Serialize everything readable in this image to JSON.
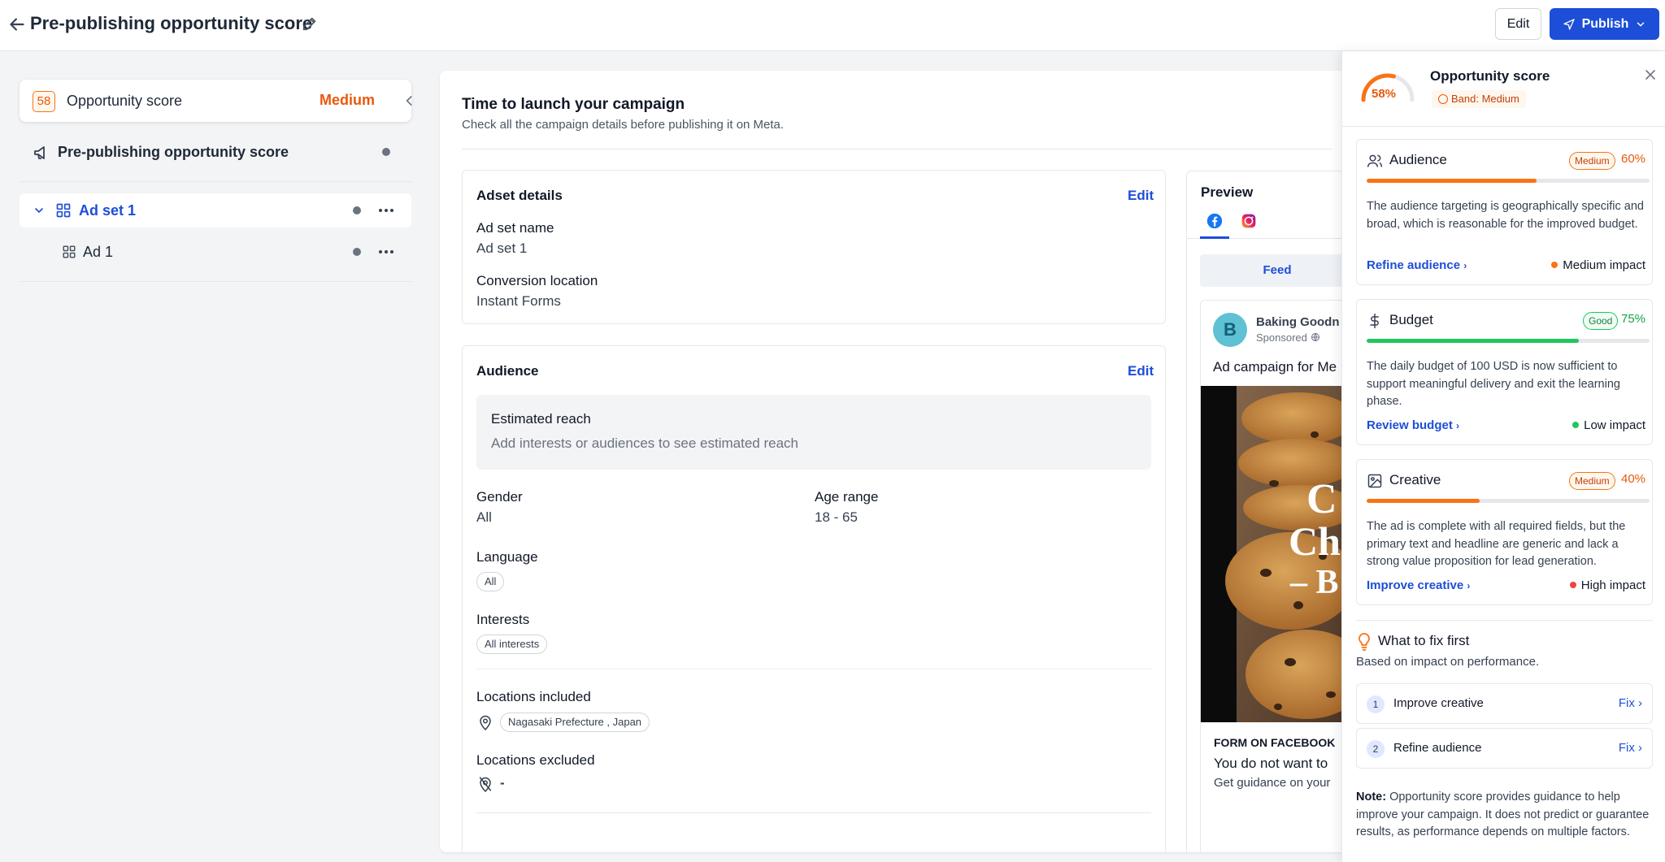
{
  "header": {
    "title": "Pre-publishing opportunity score",
    "edit_label": "Edit",
    "publish_label": "Publish"
  },
  "sidebar": {
    "score_value": "58",
    "score_label": "Opportunity score",
    "score_band": "Medium",
    "prepub_label": "Pre-publishing opportunity score",
    "adset_label": "Ad set 1",
    "ad_label": "Ad 1"
  },
  "main": {
    "title": "Time to launch your campaign",
    "subtitle": "Check all the campaign details before publishing it on Meta.",
    "adset_details": {
      "title": "Adset details",
      "edit": "Edit",
      "name_label": "Ad set name",
      "name_value": "Ad set 1",
      "conv_label": "Conversion location",
      "conv_value": "Instant Forms"
    },
    "audience": {
      "title": "Audience",
      "edit": "Edit",
      "reach_label": "Estimated reach",
      "reach_hint": "Add interests or audiences to see estimated reach",
      "gender_label": "Gender",
      "gender_value": "All",
      "age_label": "Age range",
      "age_value": "18 - 65",
      "language_label": "Language",
      "language_chip": "All",
      "interests_label": "Interests",
      "interests_chip": "All interests",
      "loc_in_label": "Locations included",
      "loc_in_chip": "Nagasaki Prefecture , Japan",
      "loc_ex_label": "Locations excluded",
      "loc_ex_value": "-"
    },
    "preview": {
      "title": "Preview",
      "feed_tab": "Feed",
      "avatar_letter": "B",
      "brand": "Baking Goodn",
      "sponsored": "Sponsored",
      "caption": "Ad campaign for Me",
      "img_text1": "C",
      "img_text2": "Ch",
      "img_text3": "– B",
      "foot1": "FORM ON FACEBOOK",
      "foot2": "You do not want to",
      "foot3": "Get guidance on your"
    }
  },
  "panel": {
    "score_pct": "58%",
    "score_fraction": 0.58,
    "title": "Opportunity score",
    "band": "Band: Medium",
    "criteria": [
      {
        "name": "Audience",
        "badge": "Medium",
        "pct": "60%",
        "level": 0.6,
        "color": "#f97316",
        "desc": "The audience targeting is geographically specific and broad, which is reasonable for the improved budget.",
        "action": "Refine audience",
        "impact": "Medium impact",
        "impact_color": "#f97316"
      },
      {
        "name": "Budget",
        "badge": "Good",
        "pct": "75%",
        "level": 0.75,
        "color": "#22c55e",
        "desc": "The daily budget of 100 USD is now sufficient to support meaningful delivery and exit the learning phase.",
        "action": "Review budget",
        "impact": "Low impact",
        "impact_color": "#22c55e"
      },
      {
        "name": "Creative",
        "badge": "Medium",
        "pct": "40%",
        "level": 0.4,
        "color": "#f97316",
        "desc": "The ad is complete with all required fields, but the primary text and headline are generic and lack a strong value proposition for lead generation.",
        "action": "Improve creative",
        "impact": "High impact",
        "impact_color": "#ef4444"
      }
    ],
    "fix_title": "What to fix first",
    "fix_subtitle": "Based on impact on performance.",
    "fixes": [
      {
        "num": "1",
        "label": "Improve creative",
        "fix": "Fix"
      },
      {
        "num": "2",
        "label": "Refine audience",
        "fix": "Fix"
      }
    ],
    "note_label": "Note:",
    "note_text": "Opportunity score provides guidance to help improve your campaign. It does not predict or guarantee results, as performance depends on multiple factors."
  }
}
